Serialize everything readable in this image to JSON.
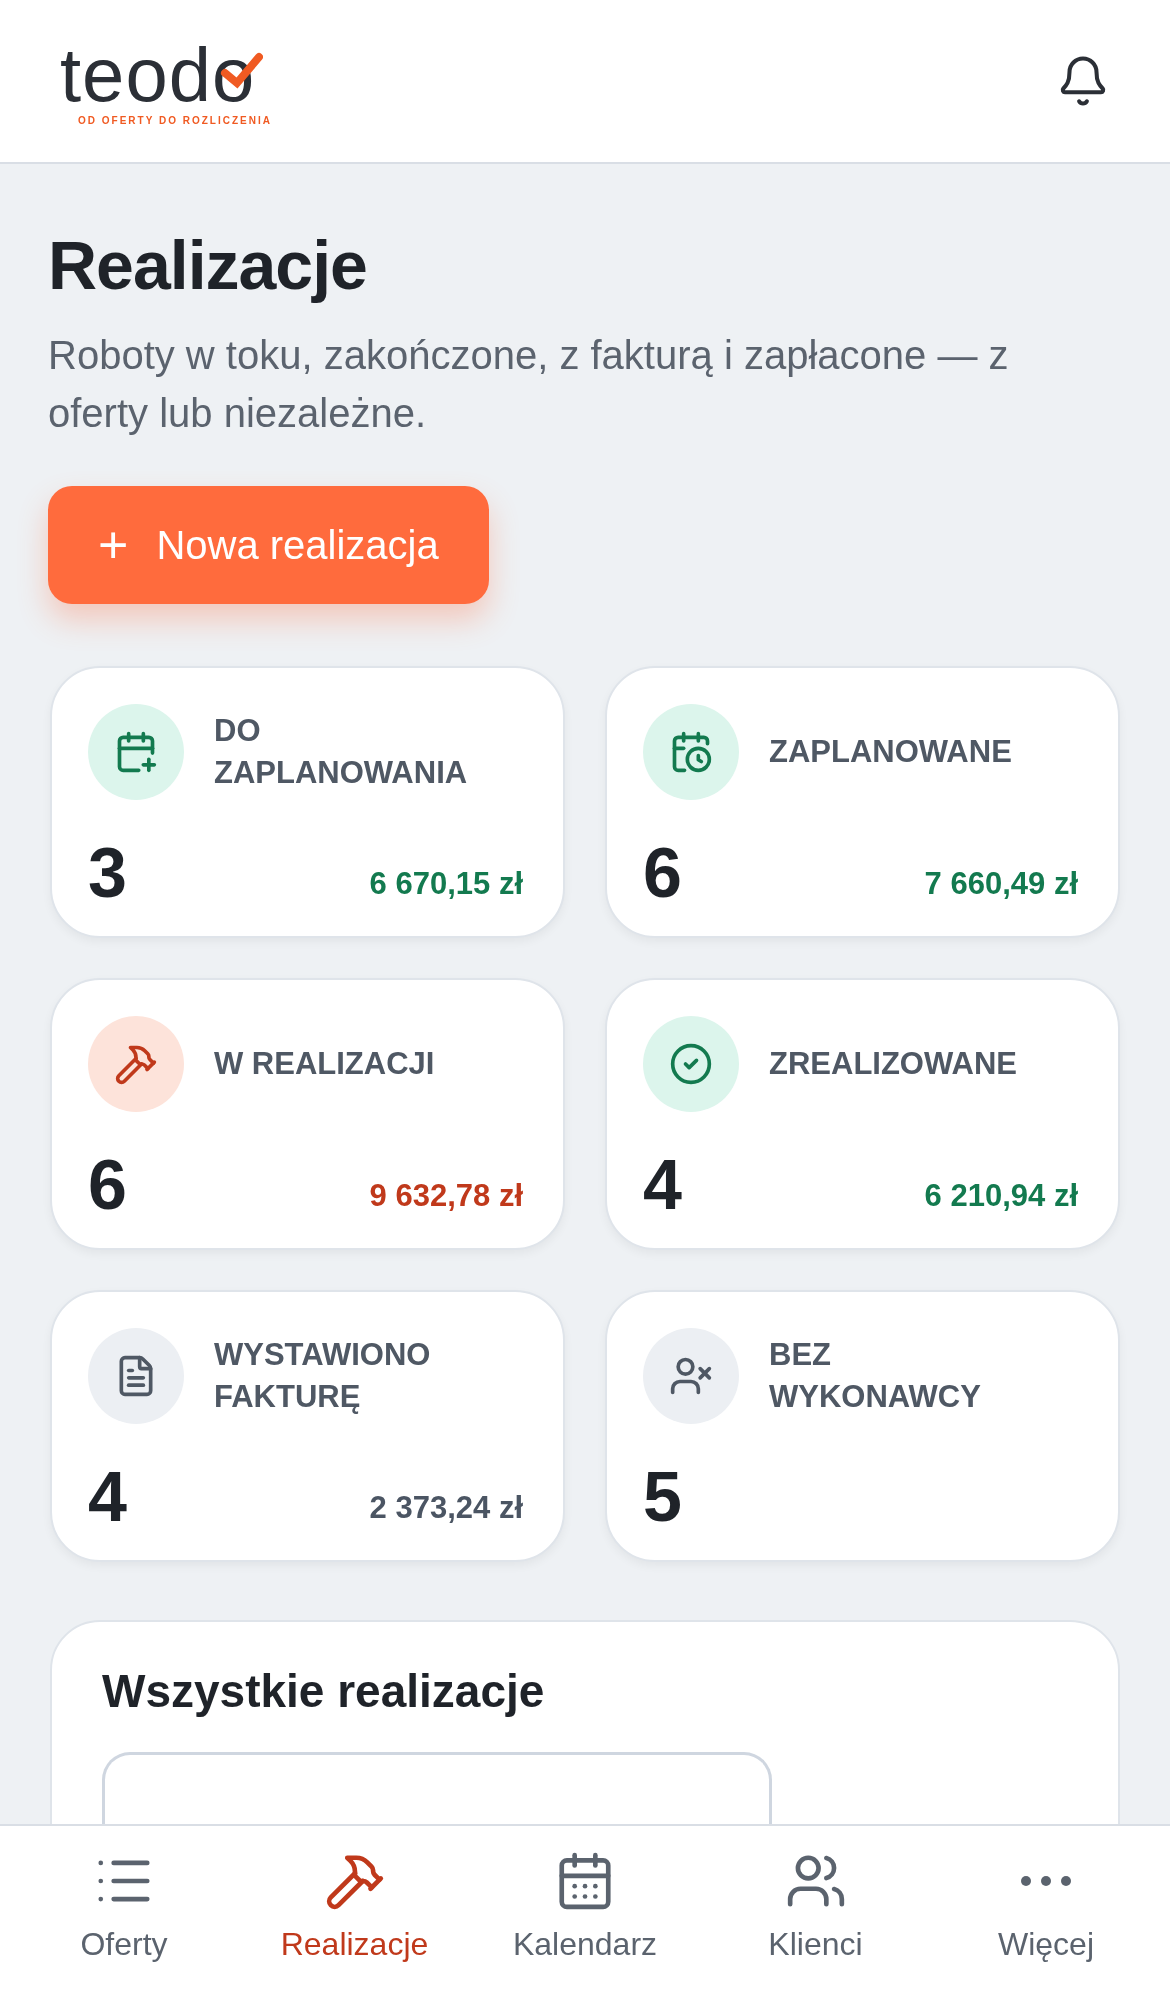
{
  "logo": {
    "name": "teodo",
    "tagline": "OD OFERTY DO ROZLICZENIA"
  },
  "page": {
    "title": "Realizacje",
    "subtitle": "Roboty w toku, zakończone, z fakturą i zapłacone — z oferty lub niezależne."
  },
  "new_button": {
    "icon": "+",
    "label": "Nowa realizacja"
  },
  "stats": [
    {
      "label": "DO ZAPLANOWANIA",
      "count": "3",
      "amount": "6 670,15 zł",
      "color": "#137a4f"
    },
    {
      "label": "ZAPLANOWANE",
      "count": "6",
      "amount": "7 660,49 zł",
      "color": "#137a4f"
    },
    {
      "label": "W REALIZACJI",
      "count": "6",
      "amount": "9 632,78 zł",
      "color": "#c0391b"
    },
    {
      "label": "ZREALIZOWANE",
      "count": "4",
      "amount": "6 210,94 zł",
      "color": "#137a4f"
    },
    {
      "label": "WYSTAWIONO FAKTURĘ",
      "count": "4",
      "amount": "2 373,24 zł",
      "color": "#4b5563"
    },
    {
      "label": "BEZ WYKONAWCY",
      "count": "5"
    }
  ],
  "list_section": {
    "title": "Wszystkie realizacje"
  },
  "nav": [
    {
      "label": "Oferty",
      "selected": false
    },
    {
      "label": "Realizacje",
      "selected": true
    },
    {
      "label": "Kalendarz",
      "selected": false
    },
    {
      "label": "Klienci",
      "selected": false
    },
    {
      "label": "Więcej",
      "selected": false
    }
  ]
}
